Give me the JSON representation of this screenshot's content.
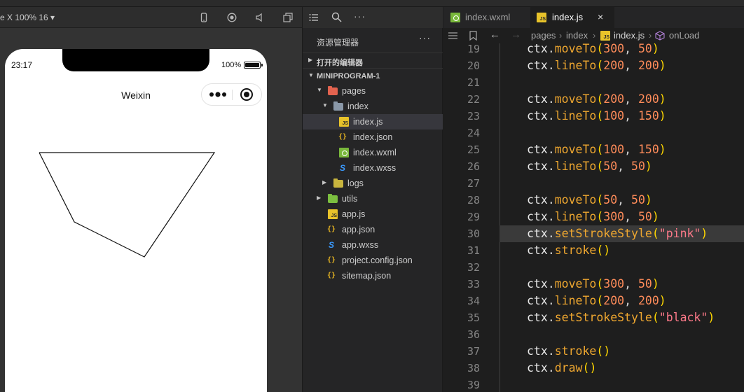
{
  "simulator": {
    "device_label": "e X 100% 16 ▾",
    "toolbar_icons": [
      "phone-icon",
      "record-icon",
      "volume-icon",
      "window-icon"
    ],
    "status_time": "23:17",
    "battery_pct": "100%",
    "battery_level": 1.0,
    "nav_title": "Weixin"
  },
  "explorer": {
    "header": "资源管理器",
    "more": "···",
    "section_open_editors": "打开的编辑器",
    "section_project": "MINIPROGRAM-1",
    "tree": [
      {
        "name": "pages",
        "icon": "folder-red-icon",
        "type": "folder-open"
      },
      {
        "name": "index",
        "icon": "folder-icon",
        "type": "folder-open"
      },
      {
        "name": "index.js",
        "icon": "js-file-icon",
        "type": "file",
        "selected": true
      },
      {
        "name": "index.json",
        "icon": "json-file-icon",
        "type": "file"
      },
      {
        "name": "index.wxml",
        "icon": "wxml-file-icon",
        "type": "file"
      },
      {
        "name": "index.wxss",
        "icon": "wxss-file-icon",
        "type": "file"
      },
      {
        "name": "logs",
        "icon": "folder-yellow-icon",
        "type": "folder-closed"
      },
      {
        "name": "utils",
        "icon": "folder-green-icon",
        "type": "folder-closed"
      },
      {
        "name": "app.js",
        "icon": "js-file-icon",
        "type": "file"
      },
      {
        "name": "app.json",
        "icon": "json-file-icon",
        "type": "file"
      },
      {
        "name": "app.wxss",
        "icon": "wxss-file-icon",
        "type": "file"
      },
      {
        "name": "project.config.json",
        "icon": "json-file-icon",
        "type": "file"
      },
      {
        "name": "sitemap.json",
        "icon": "json-file-icon",
        "type": "file"
      }
    ]
  },
  "editor": {
    "tabs": [
      {
        "label": "index.wxml",
        "icon": "wxml-file-icon",
        "active": false
      },
      {
        "label": "index.js",
        "icon": "js-file-icon",
        "active": true
      }
    ],
    "tab_close": "×",
    "breadcrumb": [
      "pages",
      "index",
      "index.js",
      "onLoad"
    ],
    "lines": [
      {
        "num": "19",
        "code": "    ctx.moveTo(300, 50)"
      },
      {
        "num": "20",
        "code": "    ctx.lineTo(200, 200)"
      },
      {
        "num": "21",
        "code": ""
      },
      {
        "num": "22",
        "code": "    ctx.moveTo(200, 200)"
      },
      {
        "num": "23",
        "code": "    ctx.lineTo(100, 150)"
      },
      {
        "num": "24",
        "code": ""
      },
      {
        "num": "25",
        "code": "    ctx.moveTo(100, 150)"
      },
      {
        "num": "26",
        "code": "    ctx.lineTo(50, 50)"
      },
      {
        "num": "27",
        "code": ""
      },
      {
        "num": "28",
        "code": "    ctx.moveTo(50, 50)"
      },
      {
        "num": "29",
        "code": "    ctx.lineTo(300, 50)"
      },
      {
        "num": "30",
        "code": "    ctx.setStrokeStyle(\"pink\")",
        "highlight": true
      },
      {
        "num": "31",
        "code": "    ctx.stroke()"
      },
      {
        "num": "32",
        "code": ""
      },
      {
        "num": "33",
        "code": "    ctx.moveTo(300, 50)"
      },
      {
        "num": "34",
        "code": "    ctx.lineTo(200, 200)"
      },
      {
        "num": "35",
        "code": "    ctx.setStrokeStyle(\"black\")"
      },
      {
        "num": "36",
        "code": ""
      },
      {
        "num": "37",
        "code": "    ctx.stroke()"
      },
      {
        "num": "38",
        "code": "    ctx.draw()"
      },
      {
        "num": "39",
        "code": ""
      }
    ]
  },
  "colors": {
    "editor_bg": "#1e1e1e",
    "sidebar_bg": "#252526",
    "function": "#f0a830",
    "number": "#ff8c5a",
    "string": "#ff7a8a",
    "paren": "#ffd700"
  }
}
